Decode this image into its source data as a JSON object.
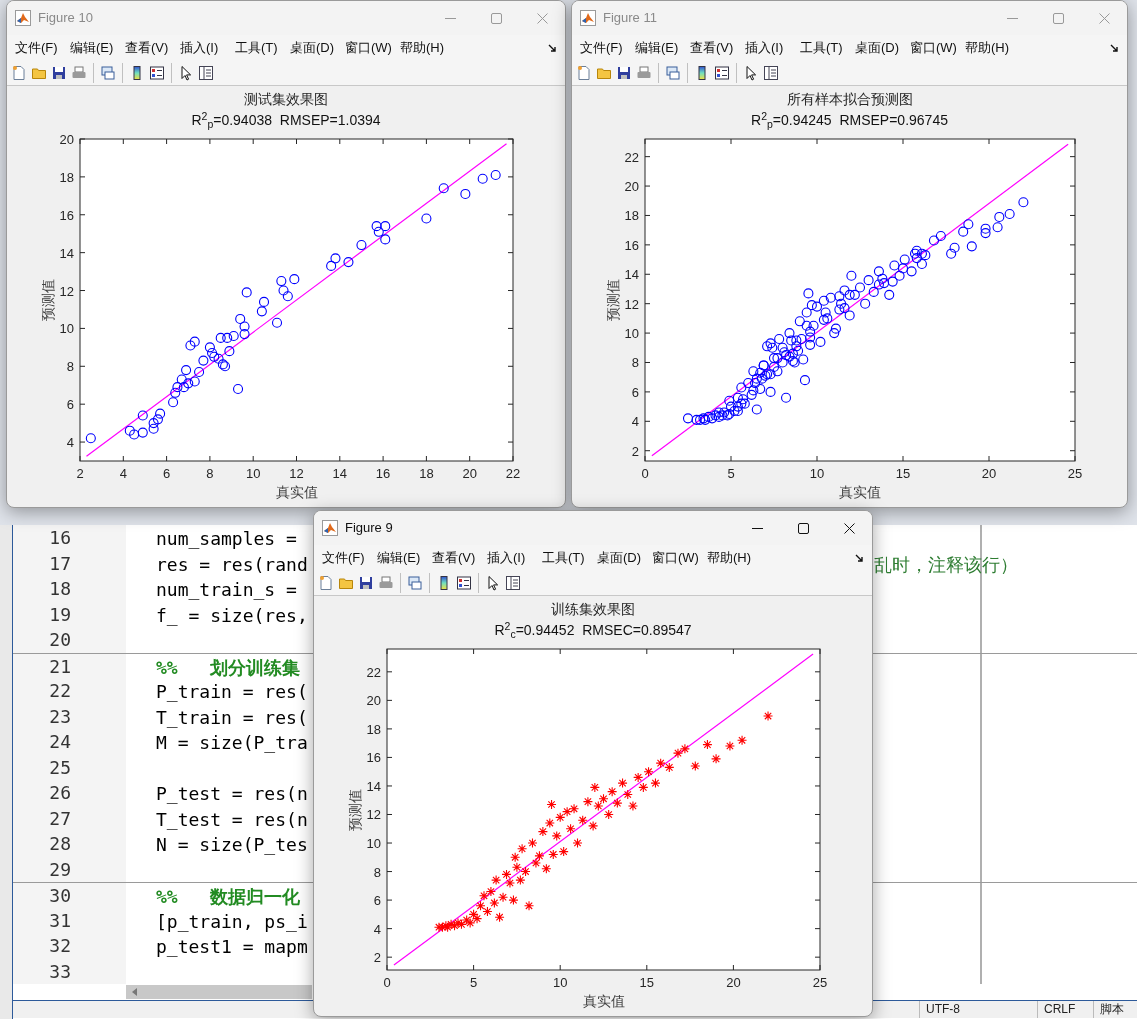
{
  "figures": [
    {
      "title": "Figure 10",
      "active": false,
      "menu": [
        "文件(F)",
        "编辑(E)",
        "查看(V)",
        "插入(I)",
        "工具(T)",
        "桌面(D)",
        "窗口(W)",
        "帮助(H)"
      ],
      "metrics": "R$^{2}$$_{p}$=0.94038  RMSEP=1.0394",
      "chart_data": {
        "type": "scatter",
        "title": "测试集效果图",
        "xlabel": "真实值",
        "ylabel": "预测值",
        "xlim": [
          2,
          22
        ],
        "ylim": [
          3,
          20
        ],
        "xticks": [
          2,
          4,
          6,
          8,
          10,
          12,
          14,
          16,
          18,
          20,
          22
        ],
        "yticks": [
          4,
          6,
          8,
          10,
          12,
          14,
          16,
          18,
          20
        ],
        "x": [
          2.5,
          4.3,
          4.5,
          4.9,
          4.9,
          5.4,
          5.4,
          5.6,
          5.7,
          6.3,
          6.4,
          6.5,
          6.7,
          6.8,
          6.9,
          7.0,
          7.1,
          7.3,
          7.3,
          7.5,
          7.7,
          8.0,
          8.1,
          8.2,
          8.4,
          8.5,
          8.6,
          8.7,
          8.8,
          8.9,
          9.1,
          9.3,
          9.4,
          9.6,
          9.6,
          9.7,
          10.4,
          10.5,
          11.1,
          11.3,
          11.4,
          11.6,
          11.9,
          13.6,
          13.8,
          14.4,
          15.0,
          15.7,
          15.8,
          16.1,
          16.1,
          18.0,
          18.8,
          19.8,
          20.6,
          21.2
        ],
        "series": [
          {
            "color": "#0000ff",
            "marker": "circle",
            "values": [
              4.2,
              4.6,
              4.4,
              5.4,
              4.5,
              4.7,
              5.0,
              5.2,
              5.5,
              6.1,
              6.6,
              6.9,
              7.3,
              6.9,
              7.8,
              7.1,
              9.1,
              9.3,
              7.2,
              7.7,
              8.3,
              9.0,
              8.7,
              8.5,
              8.4,
              9.5,
              8.1,
              8.0,
              9.5,
              8.8,
              9.6,
              6.8,
              10.5,
              10.1,
              9.7,
              11.9,
              10.9,
              11.4,
              10.3,
              12.5,
              12.0,
              11.7,
              12.6,
              13.3,
              13.7,
              13.5,
              14.4,
              15.4,
              15.1,
              14.7,
              15.4,
              15.8,
              17.4,
              17.1,
              17.9,
              18.1
            ]
          },
          {
            "type": "line",
            "color": "#ff00ff",
            "x": [
              2.3,
              21.7
            ],
            "values": [
              3.25,
              19.75
            ]
          }
        ]
      }
    },
    {
      "title": "Figure 11",
      "active": false,
      "menu": [
        "文件(F)",
        "编辑(E)",
        "查看(V)",
        "插入(I)",
        "工具(T)",
        "桌面(D)",
        "窗口(W)",
        "帮助(H)"
      ],
      "metrics": "R$^{2}$$_{p}$=0.94245  RMSEP=0.96745",
      "chart_data": {
        "type": "scatter",
        "title": "所有样本拟合预测图",
        "xlabel": "真实值",
        "ylabel": "预测值",
        "xlim": [
          0,
          25
        ],
        "ylim": [
          1.3,
          23.2
        ],
        "xticks": [
          0,
          5,
          10,
          15,
          20,
          25
        ],
        "yticks": [
          2,
          4,
          6,
          8,
          10,
          12,
          14,
          16,
          18,
          20,
          22
        ],
        "x": [
          3.0,
          3.2,
          3.4,
          3.5,
          3.7,
          3.9,
          4.1,
          4.3,
          4.6,
          4.8,
          5.0,
          5.2,
          5.4,
          5.6,
          5.8,
          6.0,
          6.2,
          6.3,
          6.5,
          6.7,
          6.9,
          7.1,
          7.3,
          7.5,
          7.7,
          7.8,
          8.0,
          8.2,
          8.4,
          8.6,
          8.8,
          9.0,
          9.2,
          9.4,
          9.6,
          9.8,
          10.0,
          10.2,
          10.4,
          10.6,
          10.8,
          11.0,
          11.3,
          11.6,
          11.9,
          12.2,
          12.5,
          12.8,
          13.0,
          13.3,
          13.6,
          13.9,
          14.2,
          14.5,
          14.8,
          15.1,
          15.5,
          15.8,
          16.3,
          16.8,
          17.2,
          17.8,
          18.5,
          19.0,
          19.8,
          20.5,
          22.0,
          12.0,
          9.5,
          7.4,
          2.5,
          4.3,
          4.5,
          4.9,
          4.9,
          5.4,
          5.4,
          5.6,
          5.7,
          6.3,
          6.4,
          6.5,
          6.7,
          6.8,
          6.9,
          7.0,
          7.1,
          7.3,
          7.3,
          7.5,
          7.7,
          8.0,
          8.1,
          8.2,
          8.4,
          8.5,
          8.6,
          8.7,
          8.8,
          8.9,
          9.1,
          9.3,
          9.4,
          9.6,
          9.6,
          9.7,
          10.4,
          10.5,
          11.1,
          11.3,
          11.4,
          11.6,
          11.9,
          13.6,
          13.8,
          14.4,
          15.0,
          15.7,
          15.8,
          16.1,
          16.1,
          18.0,
          18.8,
          19.8,
          20.6,
          21.2
        ],
        "series": [
          {
            "color": "#0000ff",
            "marker": "circle",
            "values": [
              4.1,
              4.1,
              4.2,
              4.1,
              4.3,
              4.2,
              4.4,
              4.3,
              4.6,
              4.4,
              5.0,
              4.7,
              5.6,
              6.3,
              5.2,
              6.6,
              5.8,
              7.4,
              4.8,
              6.2,
              7.8,
              7.2,
              6.0,
              8.3,
              7.4,
              9.6,
              8.0,
              5.6,
              10.0,
              8.6,
              9.1,
              10.8,
              8.2,
              11.4,
              9.2,
              10.5,
              11.8,
              9.4,
              12.2,
              11.0,
              12.4,
              10.0,
              11.6,
              12.9,
              11.2,
              12.6,
              13.1,
              12.0,
              13.6,
              12.8,
              14.2,
              13.4,
              12.6,
              14.6,
              13.9,
              15.0,
              14.2,
              15.6,
              15.3,
              16.3,
              16.6,
              15.4,
              16.9,
              15.9,
              16.8,
              17.2,
              18.9,
              13.9,
              12.7,
              9.0,
              4.2,
              4.6,
              4.4,
              5.4,
              4.5,
              4.7,
              5.0,
              5.2,
              5.5,
              6.1,
              6.6,
              6.9,
              7.3,
              6.9,
              7.8,
              7.1,
              9.1,
              9.3,
              7.2,
              7.7,
              8.3,
              9.0,
              8.7,
              8.5,
              8.4,
              9.5,
              8.1,
              8.0,
              9.5,
              8.8,
              9.6,
              6.8,
              10.5,
              10.1,
              9.7,
              11.9,
              10.9,
              11.4,
              10.3,
              12.5,
              12.0,
              11.7,
              12.6,
              13.3,
              13.7,
              13.5,
              14.4,
              15.4,
              15.1,
              14.7,
              15.4,
              15.8,
              17.4,
              17.1,
              17.9,
              18.1
            ]
          },
          {
            "type": "line",
            "color": "#ff00ff",
            "x": [
              0.4,
              24.6
            ],
            "values": [
              1.65,
              22.85
            ]
          }
        ]
      }
    },
    {
      "title": "Figure 9",
      "active": true,
      "menu": [
        "文件(F)",
        "编辑(E)",
        "查看(V)",
        "插入(I)",
        "工具(T)",
        "桌面(D)",
        "窗口(W)",
        "帮助(H)"
      ],
      "metrics": "R$^{2}$$_{c}$=0.94452  RMSEC=0.89547",
      "chart_data": {
        "type": "scatter",
        "title": "训练集效果图",
        "xlabel": "真实值",
        "ylabel": "预测值",
        "xlim": [
          0,
          25
        ],
        "ylim": [
          1.1,
          23.6
        ],
        "xticks": [
          0,
          5,
          10,
          15,
          20,
          25
        ],
        "yticks": [
          2,
          4,
          6,
          8,
          10,
          12,
          14,
          16,
          18,
          20,
          22
        ],
        "x": [
          3.0,
          3.2,
          3.4,
          3.5,
          3.7,
          3.9,
          4.1,
          4.3,
          4.6,
          4.8,
          5.0,
          5.2,
          5.4,
          5.6,
          5.8,
          6.0,
          6.2,
          6.3,
          6.5,
          6.7,
          6.9,
          7.1,
          7.3,
          7.5,
          7.7,
          7.8,
          8.0,
          8.2,
          8.4,
          8.6,
          8.8,
          9.0,
          9.2,
          9.4,
          9.6,
          9.8,
          10.0,
          10.2,
          10.4,
          10.6,
          10.8,
          11.0,
          11.3,
          11.6,
          11.9,
          12.2,
          12.5,
          12.8,
          13.0,
          13.3,
          13.6,
          13.9,
          14.2,
          14.5,
          14.8,
          15.1,
          15.5,
          15.8,
          16.3,
          16.8,
          17.2,
          17.8,
          18.5,
          19.0,
          19.8,
          20.5,
          22.0,
          12.0,
          9.5,
          7.4
        ],
        "series": [
          {
            "color": "#ff0000",
            "marker": "cross",
            "values": [
              4.1,
              4.1,
              4.2,
              4.1,
              4.3,
              4.2,
              4.4,
              4.3,
              4.6,
              4.4,
              5.0,
              4.7,
              5.6,
              6.3,
              5.2,
              6.6,
              5.8,
              7.4,
              4.8,
              6.2,
              7.8,
              7.2,
              6.0,
              8.3,
              7.4,
              9.6,
              8.0,
              5.6,
              10.0,
              8.6,
              9.1,
              10.8,
              8.2,
              11.4,
              9.2,
              10.5,
              11.8,
              9.4,
              12.2,
              11.0,
              12.4,
              10.0,
              11.6,
              12.9,
              11.2,
              12.6,
              13.1,
              12.0,
              13.6,
              12.8,
              14.2,
              13.4,
              12.6,
              14.6,
              13.9,
              15.0,
              14.2,
              15.6,
              15.3,
              16.3,
              16.6,
              15.4,
              16.9,
              15.9,
              16.8,
              17.2,
              18.9,
              13.9,
              12.7,
              9.0
            ]
          },
          {
            "type": "line",
            "color": "#ff00ff",
            "x": [
              0.4,
              24.6
            ],
            "values": [
              1.45,
              23.25
            ]
          }
        ]
      }
    }
  ],
  "editor": {
    "lines": [
      {
        "number": "16",
        "kind": "code",
        "text": "num_samples ="
      },
      {
        "number": "17",
        "kind": "code",
        "text": "res = res(rand",
        "tail": "乱时，注释该行）"
      },
      {
        "number": "18",
        "kind": "code",
        "text": "num_train_s ="
      },
      {
        "number": "19",
        "kind": "code",
        "text": "f_ = size(res,"
      },
      {
        "number": "20",
        "kind": "blank"
      },
      {
        "number": "21",
        "kind": "section",
        "text": "%%   划分训练集"
      },
      {
        "number": "22",
        "kind": "code",
        "text": "P_train = res("
      },
      {
        "number": "23",
        "kind": "code",
        "text": "T_train = res("
      },
      {
        "number": "24",
        "kind": "code",
        "text": "M = size(P_tra"
      },
      {
        "number": "25",
        "kind": "blank"
      },
      {
        "number": "26",
        "kind": "code",
        "text": "P_test = res(n"
      },
      {
        "number": "27",
        "kind": "code",
        "text": "T_test = res(n"
      },
      {
        "number": "28",
        "kind": "code",
        "text": "N = size(P_tes"
      },
      {
        "number": "29",
        "kind": "blank"
      },
      {
        "number": "30",
        "kind": "section",
        "text": "%%   数据归一化"
      },
      {
        "number": "31",
        "kind": "code",
        "text": "[p_train, ps_i"
      },
      {
        "number": "32",
        "kind": "code",
        "text": "p_test1 = mapm"
      },
      {
        "number": "33",
        "kind": "blank"
      }
    ],
    "status_bar": [
      "UTF-8",
      "CRLF",
      "脚本"
    ]
  }
}
